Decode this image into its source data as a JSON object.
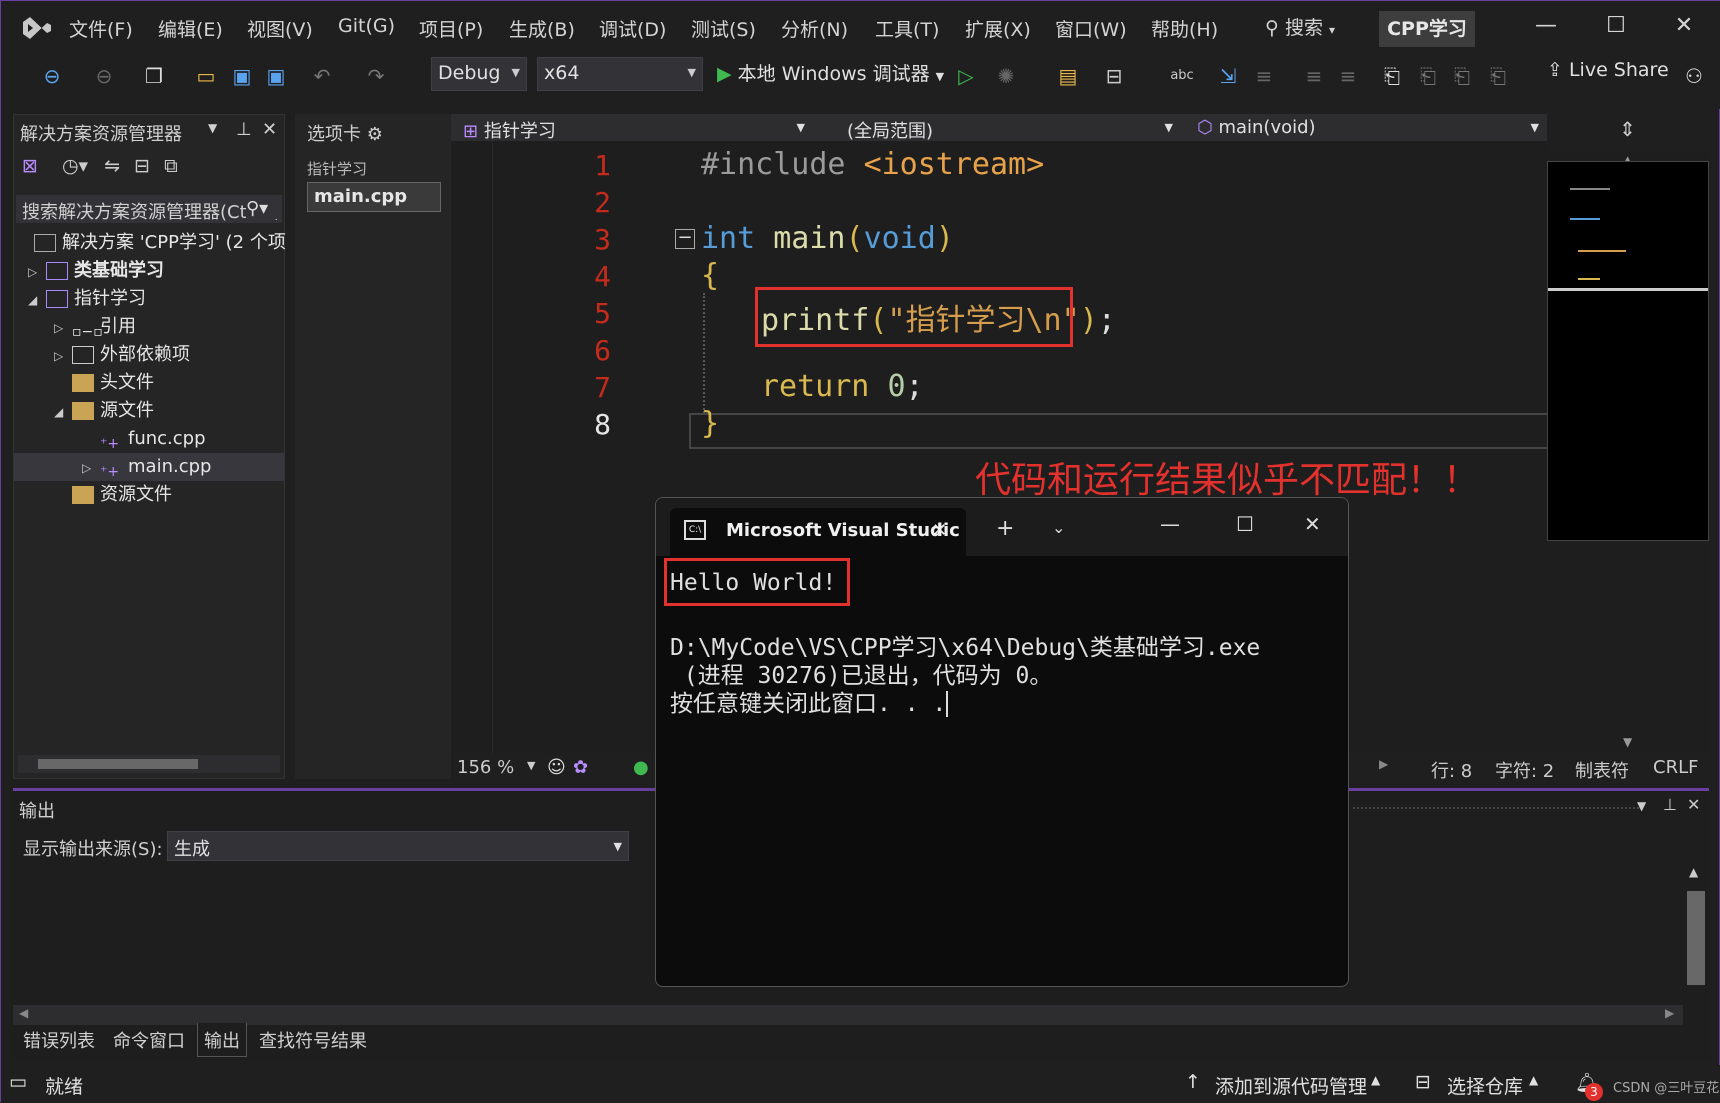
{
  "menubar": {
    "items": [
      "文件(F)",
      "编辑(E)",
      "视图(V)",
      "Git(G)",
      "项目(P)",
      "生成(B)",
      "调试(D)",
      "测试(S)",
      "分析(N)",
      "工具(T)",
      "扩展(X)",
      "窗口(W)",
      "帮助(H)"
    ],
    "search_label": "搜索",
    "project_name": "CPP学习"
  },
  "toolbar": {
    "config": "Debug",
    "platform": "x64",
    "run_label": "本地 Windows 调试器",
    "live_share": "Live Share"
  },
  "solution_explorer": {
    "title": "解决方案资源管理器",
    "search_placeholder": "搜索解决方案资源管理器(Ctrl+;)",
    "items": [
      {
        "label": "解决方案 'CPP学习' (2 个项",
        "icon": "solution-icon"
      },
      {
        "label": "类基础学习",
        "icon": "project-icon",
        "bold": true
      },
      {
        "label": "指针学习",
        "icon": "project-icon"
      },
      {
        "label": "引用",
        "icon": "reference-icon"
      },
      {
        "label": "外部依赖项",
        "icon": "external-deps-icon"
      },
      {
        "label": "头文件",
        "icon": "folder-filter-icon"
      },
      {
        "label": "源文件",
        "icon": "folder-filter-icon"
      },
      {
        "label": "func.cpp",
        "icon": "cpp-file-icon"
      },
      {
        "label": "main.cpp",
        "icon": "cpp-file-icon"
      },
      {
        "label": "资源文件",
        "icon": "folder-filter-icon"
      }
    ]
  },
  "tabs_panel": {
    "title": "选项卡",
    "group": "指针学习",
    "active_file": "main.cpp"
  },
  "editor": {
    "nav_project": "指针学习",
    "nav_scope": "(全局范围)",
    "nav_function": "main(void)",
    "line_numbers": [
      "1",
      "2",
      "3",
      "4",
      "5",
      "6",
      "7",
      "8"
    ],
    "code": {
      "l1_directive": "#include",
      "l1_header": "<iostream>",
      "l3_type": "int",
      "l3_fn": "main",
      "l3_param": "void",
      "l4": "{",
      "l5_fn": "printf",
      "l5_str": "\"指针学习\\n\"",
      "l7_kw": "return",
      "l7_num": "0",
      "l8": "}"
    },
    "zoom": "156 %",
    "position_line": "行: 8",
    "position_char": "字符: 2",
    "indent": "制表符",
    "eol": "CRLF"
  },
  "annotation": "代码和运行结果似乎不匹配！！",
  "console": {
    "tab_title": "Microsoft Visual Studic",
    "line1": "Hello World!",
    "line2": "D:\\MyCode\\VS\\CPP学习\\x64\\Debug\\类基础学习.exe",
    "line3": " (进程 30276)已退出，代码为 0。",
    "line4": "按任意键关闭此窗口. . ."
  },
  "output": {
    "title": "输出",
    "source_label": "显示输出来源(S):",
    "source_value": "生成"
  },
  "bottom_tabs": [
    "错误列表",
    "命令窗口",
    "输出",
    "查找符号结果"
  ],
  "statusbar": {
    "ready": "就绪",
    "add_source": "添加到源代码管理",
    "select_repo": "选择仓库",
    "notif_count": "3",
    "watermark": "CSDN @三叶豆花"
  },
  "colors": {
    "accent": "#6a3fa0",
    "error_red": "#e3312d",
    "keyword_blue": "#569cd6",
    "string_orange": "#d69d4d"
  }
}
